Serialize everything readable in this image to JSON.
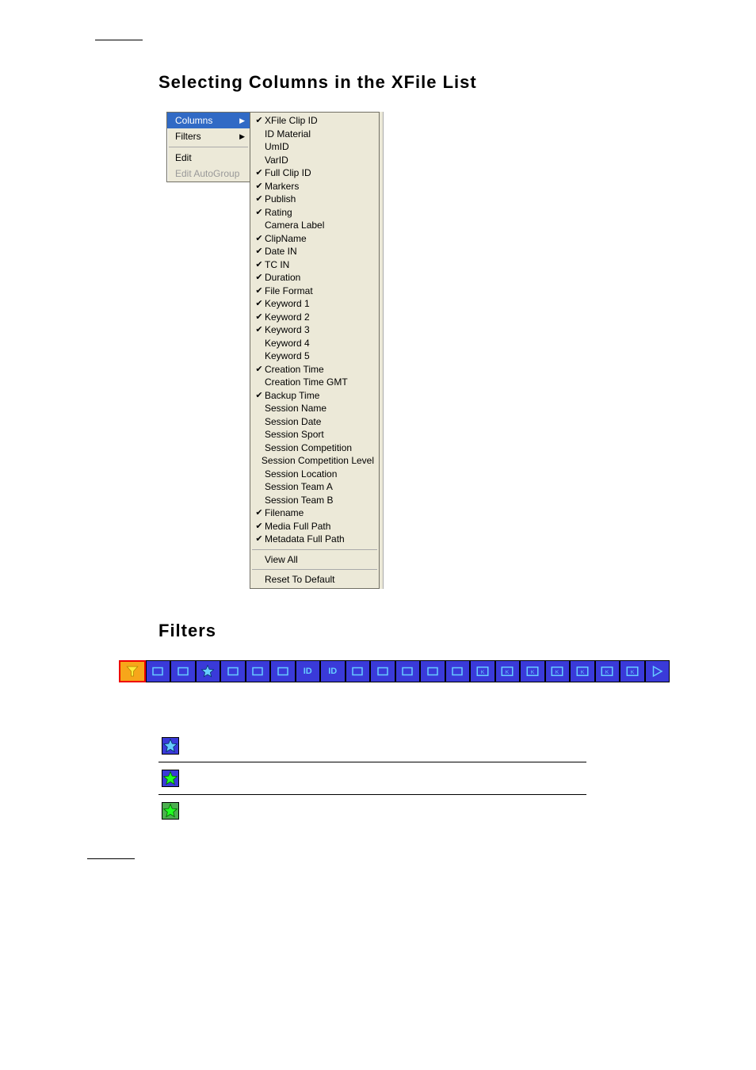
{
  "headings": {
    "h1": "Selecting Columns in the XFile List",
    "h2": "Filters"
  },
  "context_menu": {
    "items": [
      {
        "label": "Columns",
        "arrow": true,
        "selected": true,
        "disabled": false
      },
      {
        "label": "Filters",
        "arrow": true,
        "selected": false,
        "disabled": false
      }
    ],
    "items2": [
      {
        "label": "Edit",
        "arrow": false,
        "selected": false,
        "disabled": false
      },
      {
        "label": "Edit AutoGroup",
        "arrow": false,
        "selected": false,
        "disabled": true
      }
    ]
  },
  "submenu": {
    "items": [
      {
        "label": "XFile Clip ID",
        "checked": true
      },
      {
        "label": "ID Material",
        "checked": false
      },
      {
        "label": "UmID",
        "checked": false
      },
      {
        "label": "VarID",
        "checked": false
      },
      {
        "label": "Full Clip ID",
        "checked": true
      },
      {
        "label": "Markers",
        "checked": true
      },
      {
        "label": "Publish",
        "checked": true
      },
      {
        "label": "Rating",
        "checked": true
      },
      {
        "label": "Camera Label",
        "checked": false
      },
      {
        "label": "ClipName",
        "checked": true
      },
      {
        "label": "Date IN",
        "checked": true
      },
      {
        "label": "TC IN",
        "checked": true
      },
      {
        "label": "Duration",
        "checked": true
      },
      {
        "label": "File Format",
        "checked": true
      },
      {
        "label": "Keyword 1",
        "checked": true
      },
      {
        "label": "Keyword 2",
        "checked": true
      },
      {
        "label": "Keyword 3",
        "checked": true
      },
      {
        "label": "Keyword 4",
        "checked": false
      },
      {
        "label": "Keyword 5",
        "checked": false
      },
      {
        "label": "Creation Time",
        "checked": true
      },
      {
        "label": "Creation Time GMT",
        "checked": false
      },
      {
        "label": "Backup Time",
        "checked": true
      },
      {
        "label": "Session Name",
        "checked": false
      },
      {
        "label": "Session Date",
        "checked": false
      },
      {
        "label": "Session Sport",
        "checked": false
      },
      {
        "label": "Session Competition",
        "checked": false
      },
      {
        "label": "Session Competition Level",
        "checked": false
      },
      {
        "label": "Session Location",
        "checked": false
      },
      {
        "label": "Session Team A",
        "checked": false
      },
      {
        "label": "Session Team B",
        "checked": false
      },
      {
        "label": "Filename",
        "checked": true
      },
      {
        "label": "Media Full Path",
        "checked": true
      },
      {
        "label": "Metadata Full Path",
        "checked": true
      }
    ],
    "footer": [
      {
        "label": "View All"
      },
      {
        "label": "Reset To Default"
      }
    ]
  },
  "toolbar_icons": [
    "filter-icon",
    "diamond-icon",
    "folder-clip-icon",
    "star-icon",
    "folder-open-icon",
    "undo-icon",
    "redo-key-icon",
    "id-icon",
    "id2-icon",
    "grid-icon",
    "screen-plus-icon",
    "list-icon",
    "box-up-icon",
    "export-icon",
    "kw1-icon",
    "kw2-icon",
    "kw3-icon",
    "kw4-icon",
    "kw5-icon",
    "kwx-icon",
    "kwy-icon",
    "play-icon"
  ],
  "legend": [
    {
      "bg": "blue",
      "fill": "blue",
      "name": "star-outline-icon"
    },
    {
      "bg": "blue",
      "fill": "green",
      "name": "star-green-icon"
    },
    {
      "bg": "green",
      "fill": "green",
      "name": "star-green-bg-icon"
    }
  ]
}
